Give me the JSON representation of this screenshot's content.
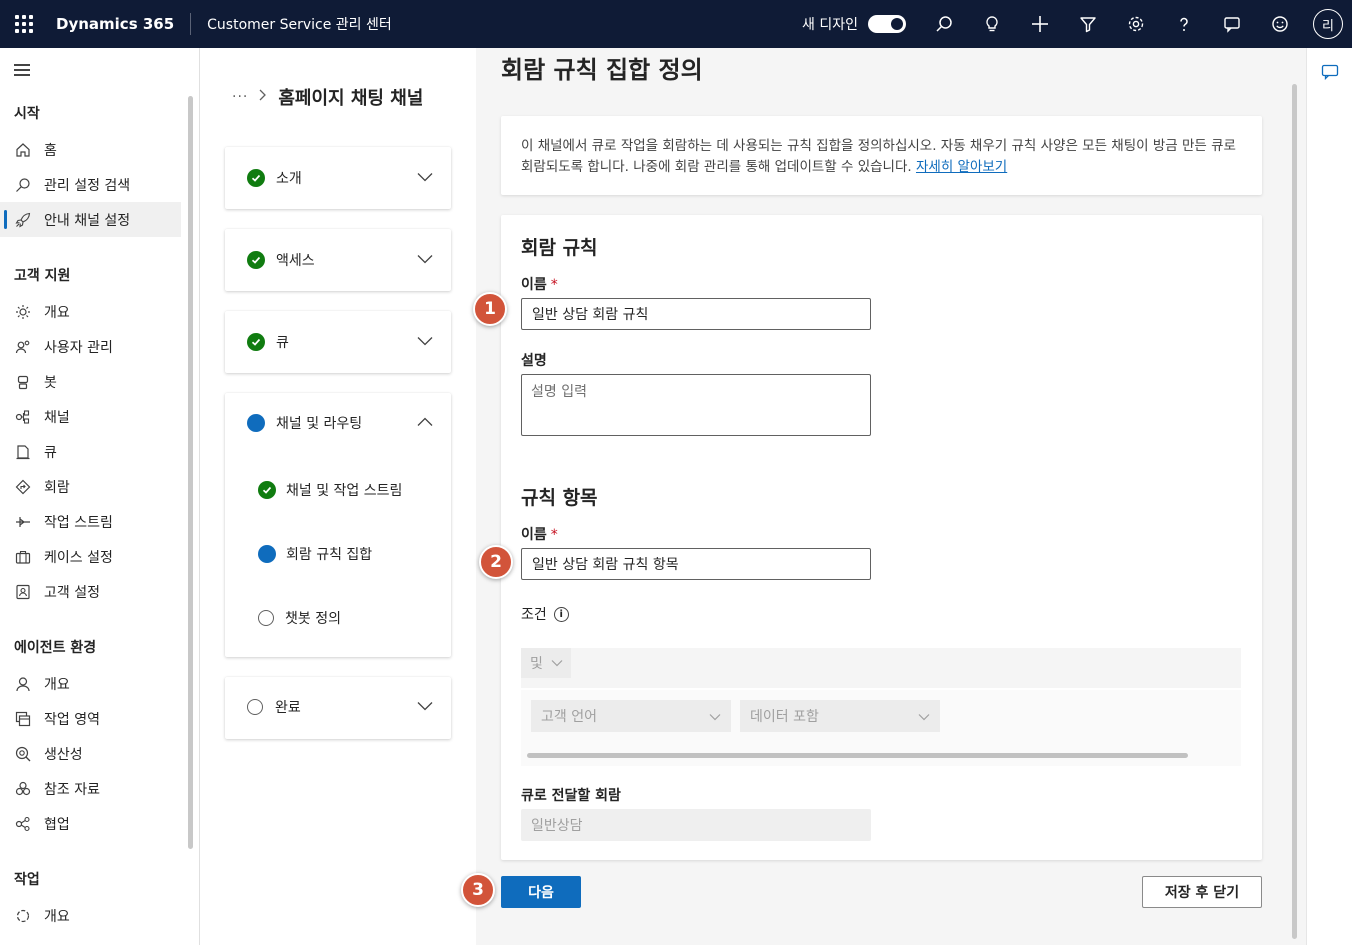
{
  "topbar": {
    "brand": "Dynamics 365",
    "app_name": "Customer Service 관리 센터",
    "new_design_label": "새 디자인",
    "new_design_on": true,
    "avatar_initial": "리",
    "bg_color": "#0f1b36"
  },
  "leftnav": {
    "sections": [
      {
        "title": "시작",
        "items": [
          {
            "label": "홈",
            "icon": "home-icon"
          },
          {
            "label": "관리 설정 검색",
            "icon": "search-icon"
          },
          {
            "label": "안내 채널 설정",
            "icon": "rocket-icon",
            "active": true
          }
        ]
      },
      {
        "title": "고객 지원",
        "items": [
          {
            "label": "개요",
            "icon": "overview-icon"
          },
          {
            "label": "사용자 관리",
            "icon": "users-icon"
          },
          {
            "label": "봇",
            "icon": "bot-icon"
          },
          {
            "label": "채널",
            "icon": "channels-icon"
          },
          {
            "label": "큐",
            "icon": "queue-icon"
          },
          {
            "label": "회람",
            "icon": "routing-icon"
          },
          {
            "label": "작업 스트림",
            "icon": "workstream-icon"
          },
          {
            "label": "케이스 설정",
            "icon": "case-icon"
          },
          {
            "label": "고객 설정",
            "icon": "customer-icon"
          }
        ]
      },
      {
        "title": "에이전트 환경",
        "items": [
          {
            "label": "개요",
            "icon": "agent-overview-icon"
          },
          {
            "label": "작업 영역",
            "icon": "workspace-icon"
          },
          {
            "label": "생산성",
            "icon": "productivity-icon"
          },
          {
            "label": "참조 자료",
            "icon": "knowledge-icon"
          },
          {
            "label": "협업",
            "icon": "collaboration-icon"
          }
        ]
      },
      {
        "title": "작업",
        "items": [
          {
            "label": "개요",
            "icon": "operations-overview-icon"
          }
        ]
      }
    ]
  },
  "stepper": {
    "breadcrumb_ellipsis": "···",
    "breadcrumb_title": "홈페이지 채팅 채널",
    "steps": [
      {
        "label": "소개",
        "state": "done"
      },
      {
        "label": "액세스",
        "state": "done"
      },
      {
        "label": "큐",
        "state": "done"
      },
      {
        "label": "채널 및 라우팅",
        "state": "current",
        "substeps": [
          {
            "label": "채널 및 작업 스트림",
            "state": "done"
          },
          {
            "label": "회람 규칙 집합",
            "state": "current"
          },
          {
            "label": "챗봇 정의",
            "state": "todo"
          }
        ]
      },
      {
        "label": "완료",
        "state": "todo"
      }
    ]
  },
  "main": {
    "page_title": "회람 규칙 집합 정의",
    "info_text": "이 채널에서 큐로 작업을 회람하는 데 사용되는 규칙 집합을 정의하십시오. 자동 채우기 규칙 사양은 모든 채팅이 방금 만든 큐로 회람되도록 합니다. 나중에 회람 관리를 통해 업데이트할 수 있습니다.",
    "learn_more": "자세히 알아보기",
    "rule_section": {
      "title": "회람 규칙",
      "name_label": "이름",
      "name_value": "일반 상담 회람 규칙",
      "desc_label": "설명",
      "desc_placeholder": "설명 입력"
    },
    "item_section": {
      "title": "규칙 항목",
      "name_label": "이름",
      "name_value": "일반 상담 회람 규칙 항목",
      "condition_label": "조건",
      "and_label": "및",
      "condition_field": "고객 언어",
      "condition_operator": "데이터 포함",
      "route_label": "큐로 전달할 회람",
      "route_value": "일반상담"
    },
    "required_mark": "*",
    "next_button": "다음",
    "save_close_button": "저장 후 닫기"
  },
  "callouts": [
    "1",
    "2",
    "3"
  ],
  "colors": {
    "accent": "#0f6cbd",
    "success": "#107c10",
    "callout": "#d2543a"
  }
}
